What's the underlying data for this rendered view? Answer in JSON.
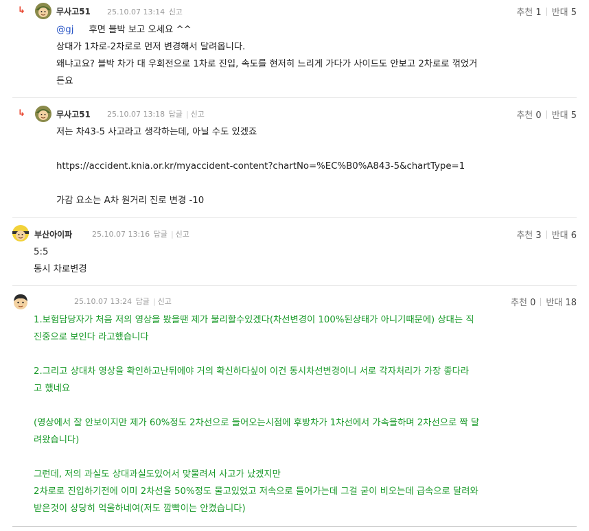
{
  "actions": {
    "reply": "답글",
    "report": "신고",
    "up_label": "추천",
    "down_label": "반대"
  },
  "comments": [
    {
      "nick": "무사고51",
      "time": "25.10.07 13:14",
      "up": "1",
      "down": "5",
      "mention": "@gj",
      "lines": [
        "후면 블박 보고 오세요 ^^",
        "상대가 1차로-2차로로 먼저 변경해서 달려옵니다.",
        "왜냐고요? 블박 차가 대 우회전으로 1차로 진입, 속도를 현저히 느리게 가다가 사이드도 안보고 2차로로 꺾었거",
        "든요"
      ]
    },
    {
      "nick": "무사고51",
      "time": "25.10.07 13:18",
      "up": "0",
      "down": "5",
      "lines": [
        "저는 차43-5 사고라고 생각하는데, 아닐 수도 있겠죠",
        "",
        "https://accident.knia.or.kr/myaccident-content?chartNo=%EC%B0%A843-5&chartType=1",
        "",
        "가감 요소는 A차 원거리 진로 변경 -10"
      ]
    },
    {
      "nick": "부산아이파",
      "time": "25.10.07 13:16",
      "up": "3",
      "down": "6",
      "lines": [
        "5:5",
        "동시 차로변경"
      ]
    },
    {
      "nick": "",
      "time": "25.10.07 13:24",
      "up": "0",
      "down": "18",
      "lines": [
        "1.보험담당자가 처음 저의 영상을 봤을땐 제가 불리할수있겠다(차선변경이 100%된상태가 아니기때문에) 상대는 직",
        "진중으로 보인다 라고했습니다",
        "",
        "2.그리고 상대차 영상을 확인하고난뒤에야 거의 확신하다싶이 이건 동시차선변경이니 서로 각자처리가 가장 좋다라",
        "고 했네요",
        "",
        "(영상에서 잘 안보이지만 제가 60%정도 2차선으로 들어오는시점에 후방차가 1차선에서 가속을하며 2차선으로 짝 달",
        "려왔습니다)",
        "",
        "그런데, 저의 과실도 상대과실도있어서 맞물려서 사고가 났겠지만",
        "2차로로 진입하기전에 이미 2차선을 50%정도 물고있었고 저속으로 들어가는데 그걸 굳이 비오는데 급속으로 달려와",
        "받은것이 상당히 억울하네여(저도 깜빡이는 안켰습니다)"
      ]
    }
  ]
}
